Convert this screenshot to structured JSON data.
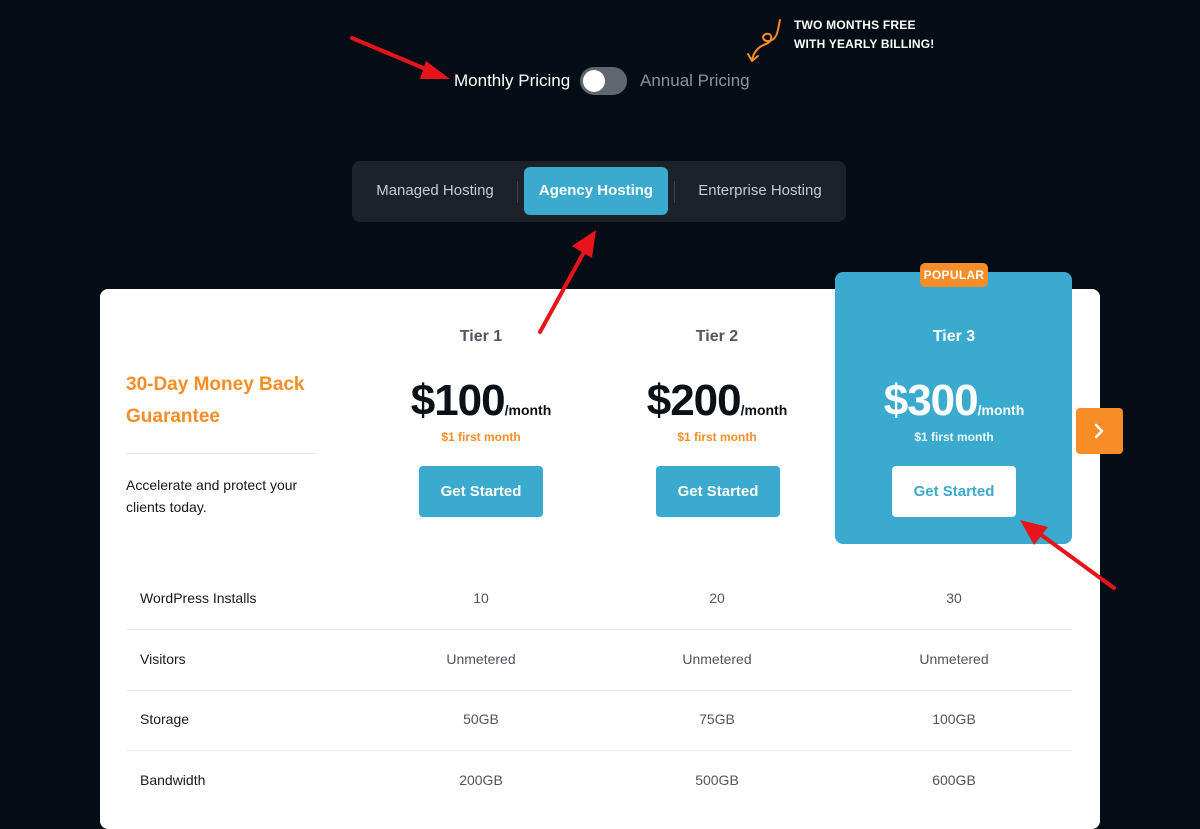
{
  "billing": {
    "monthly_label": "Monthly Pricing",
    "annual_label": "Annual Pricing",
    "toggle_state": "monthly",
    "promo_line1": "TWO MONTHS FREE",
    "promo_line2": "WITH YEARLY BILLING!"
  },
  "tabs": [
    {
      "label": "Managed Hosting",
      "active": false
    },
    {
      "label": "Agency Hosting",
      "active": true
    },
    {
      "label": "Enterprise Hosting",
      "active": false
    }
  ],
  "guarantee": {
    "title_line1": "30-Day Money Back",
    "title_line2": "Guarantee",
    "description": "Accelerate and protect your clients today."
  },
  "tiers": [
    {
      "name": "Tier 1",
      "price": "$100",
      "period": "/month",
      "first_month": "$1 first month",
      "cta": "Get Started"
    },
    {
      "name": "Tier 2",
      "price": "$200",
      "period": "/month",
      "first_month": "$1 first month",
      "cta": "Get Started"
    },
    {
      "name": "Tier 3",
      "price": "$300",
      "period": "/month",
      "first_month": "$1 first month",
      "cta": "Get Started",
      "badge": "POPULAR"
    }
  ],
  "features": [
    {
      "name": "WordPress Installs",
      "values": [
        "10",
        "20",
        "30"
      ]
    },
    {
      "name": "Visitors",
      "values": [
        "Unmetered",
        "Unmetered",
        "Unmetered"
      ]
    },
    {
      "name": "Storage",
      "values": [
        "50GB",
        "75GB",
        "100GB"
      ]
    },
    {
      "name": "Bandwidth",
      "values": [
        "200GB",
        "500GB",
        "600GB"
      ]
    }
  ],
  "icons": {
    "promo": "squiggle-arrow-icon",
    "next": "chevron-right-icon"
  },
  "colors": {
    "background": "#040d15",
    "accent_blue": "#3aaacf",
    "accent_orange": "#f68d26",
    "annotation_red": "#e8141b"
  }
}
